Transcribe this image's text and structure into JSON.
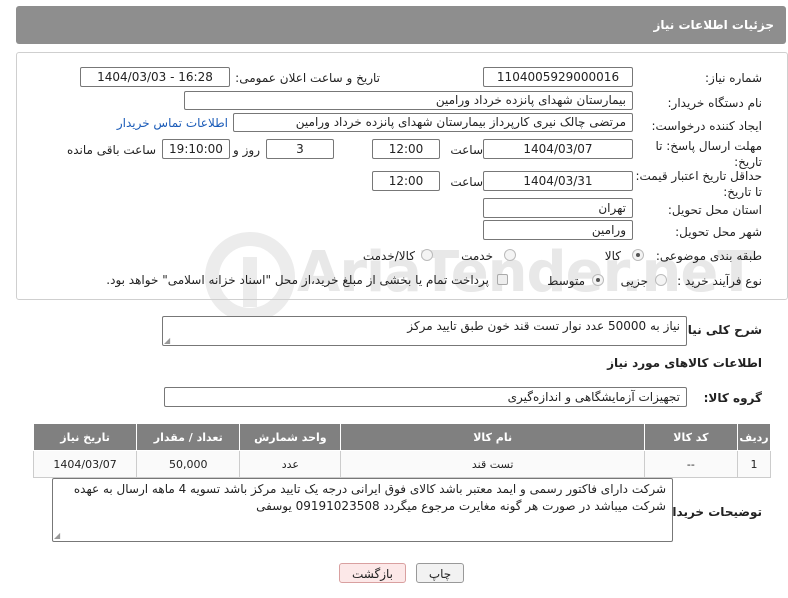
{
  "header": {
    "title": "جزئیات اطلاعات نیاز"
  },
  "watermark": "AriaTender.neT",
  "form": {
    "need_number_label": "شماره نیاز:",
    "need_number": "1104005929000016",
    "announce_label": "تاریخ و ساعت اعلان عمومی:",
    "announce_value": "1404/03/03 - 16:28",
    "buyer_org_label": "نام دستگاه خریدار:",
    "buyer_org": "بیمارستان شهدای پانزده خرداد ورامین",
    "creator_label": "ایجاد کننده درخواست:",
    "creator": "مرتضی چالک نیری کارپرداز بیمارستان شهدای پانزده خرداد ورامین",
    "contact_link": "اطلاعات تماس خریدار",
    "reply_deadline_label": "مهلت ارسال پاسخ: تا تاریخ:",
    "reply_date": "1404/03/07",
    "time_label": "ساعت",
    "reply_time": "12:00",
    "days_value": "3",
    "days_label": "روز و",
    "remaining_time": "19:10:00",
    "remaining_label": "ساعت باقی مانده",
    "price_validity_label": "حداقل تاریخ اعتبار قیمت: تا تاریخ:",
    "price_date": "1404/03/31",
    "price_time": "12:00",
    "province_label": "استان محل تحویل:",
    "province": "تهران",
    "city_label": "شهر محل تحویل:",
    "city": "ورامین",
    "category_label": "طبقه بندی موضوعی:",
    "category_options": [
      "کالا",
      "خدمت",
      "کالا/خدمت"
    ],
    "process_label": "نوع فرآیند خرید :",
    "process_options": [
      "جزیی",
      "متوسط"
    ],
    "payment_note": "پرداخت تمام یا بخشی از مبلغ خرید،از محل \"اسناد خزانه اسلامی\" خواهد بود."
  },
  "description": {
    "label": "شرح کلی نیاز:",
    "value": "نیاز به 50000 عدد نوار تست قند خون طبق تایید مرکز"
  },
  "goods": {
    "section_title": "اطلاعات کالاهای مورد نیاز",
    "group_label": "گروه کالا:",
    "group_value": "تجهیزات آزمایشگاهی و اندازه‌گیری",
    "columns": [
      "ردیف",
      "کد کالا",
      "نام کالا",
      "واحد شمارش",
      "تعداد / مقدار",
      "تاریخ نیاز"
    ],
    "rows": [
      {
        "row": "1",
        "code": "--",
        "name": "تست قند",
        "unit": "عدد",
        "qty": "50,000",
        "date": "1404/03/07"
      }
    ]
  },
  "buyer_notes": {
    "label": "توضیحات خریدار:",
    "value": "شرکت دارای فاکتور رسمی و ایمد معتبر باشد کالای فوق ایرانی درجه یک تایید مرکز باشد تسویه 4 ماهه ارسال به عهده شرکت میباشد در صورت هر گونه مغایرت مرجوع میگردد 09191023508 یوسفی"
  },
  "buttons": {
    "print": "چاپ",
    "back": "بازگشت"
  }
}
